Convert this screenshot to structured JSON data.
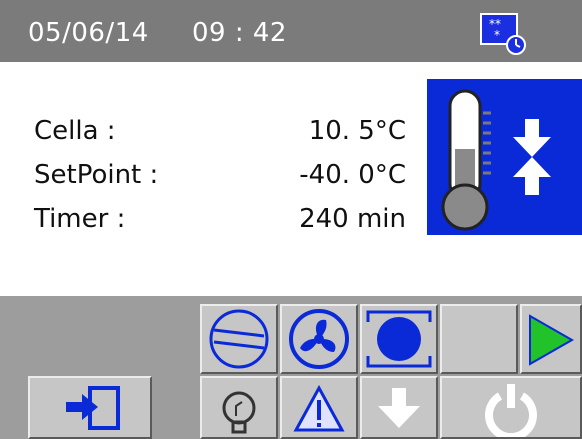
{
  "header": {
    "date": "05/06/14",
    "time": "09 : 42",
    "status_icon": "snowflake-timer-icon"
  },
  "readings": [
    {
      "label": "Cella :",
      "value": "10. 5°C"
    },
    {
      "label": "SetPoint :",
      "value": "-40. 0°C"
    },
    {
      "label": "Timer :",
      "value": "240 min"
    }
  ],
  "panel": {
    "icon": "thermometer-icon",
    "secondary_icon": "compress-arrows-icon",
    "color": "#0a2ad8"
  },
  "status_row": [
    {
      "name": "compressor-icon"
    },
    {
      "name": "fan-icon"
    },
    {
      "name": "defrost-dot-icon"
    },
    {
      "name": "blank-slot"
    },
    {
      "name": "play-icon",
      "color": "#22c22a"
    }
  ],
  "toolbar": [
    {
      "name": "exit-icon"
    },
    {
      "name": "light-bulb-icon"
    },
    {
      "name": "alarm-icon"
    },
    {
      "name": "arrow-down-icon"
    },
    {
      "name": "power-icon"
    }
  ],
  "colors": {
    "header_bg": "#7b7b7b",
    "accent_blue": "#0a2ad8",
    "button_bg": "#c6c6c6",
    "play_green": "#22c22a"
  }
}
